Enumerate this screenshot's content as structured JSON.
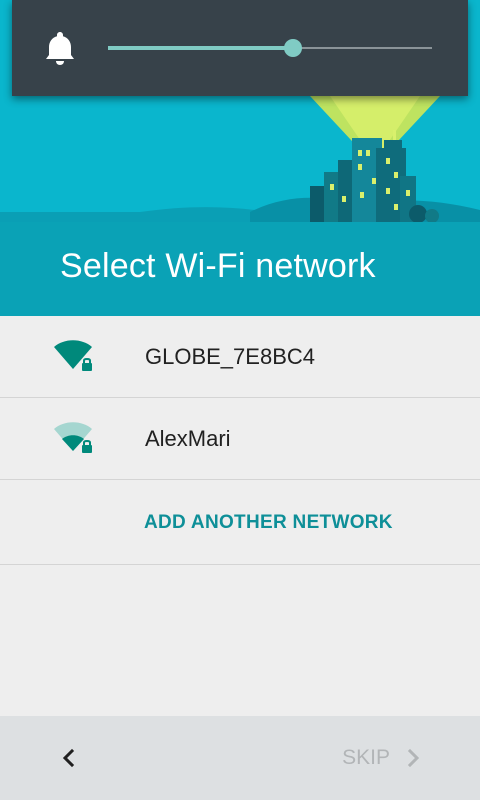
{
  "volume": {
    "icon": "bell-icon",
    "level": 0.57,
    "accent": "#80cbc4"
  },
  "header": {
    "title": "Select Wi-Fi network",
    "background": "#0ab6cd"
  },
  "networks": [
    {
      "ssid": "GLOBE_7E8BC4",
      "signal": "full",
      "secured": true,
      "icon": "wifi-lock-icon"
    },
    {
      "ssid": "AlexMari",
      "signal": "weak",
      "secured": true,
      "icon": "wifi-lock-icon"
    }
  ],
  "add_network": {
    "label": "ADD ANOTHER NETWORK"
  },
  "footer": {
    "back_icon": "chevron-left-icon",
    "skip_label": "SKIP",
    "skip_icon": "chevron-right-icon"
  }
}
